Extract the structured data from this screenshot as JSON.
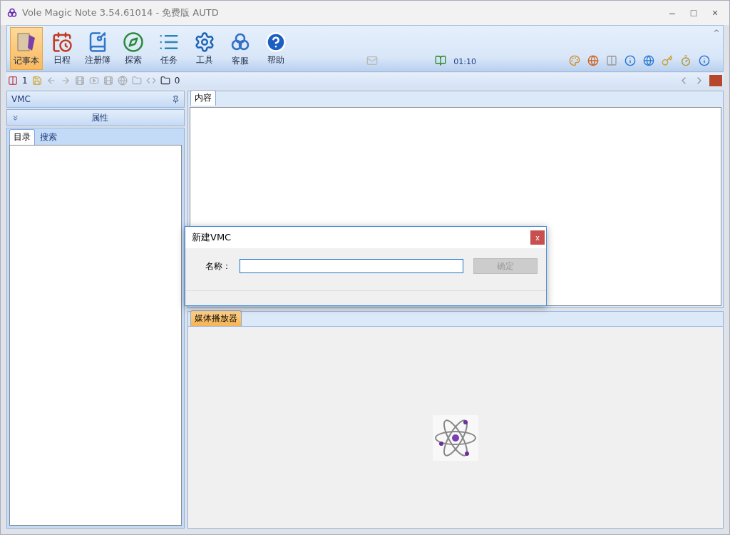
{
  "window": {
    "title": "Vole Magic Note  3.54.61014 - 免费版 AUTD",
    "controls": [
      "–",
      "□",
      "×"
    ]
  },
  "ribbon": {
    "buttons": [
      {
        "label": "记事本",
        "selected": true
      },
      {
        "label": "日程",
        "selected": false
      },
      {
        "label": "注册簿",
        "selected": false
      },
      {
        "label": "探索",
        "selected": false
      },
      {
        "label": "任务",
        "selected": false
      },
      {
        "label": "工具",
        "selected": false
      },
      {
        "label": "客服",
        "selected": false
      },
      {
        "label": "帮助",
        "selected": false
      }
    ],
    "timer": "01:10"
  },
  "toolbar": {
    "notebook_count": "1",
    "attachment_count": "0"
  },
  "left_panel": {
    "title": "VMC",
    "properties": "属性",
    "tabs": [
      {
        "label": "目录",
        "selected": true
      },
      {
        "label": "搜索",
        "selected": false
      }
    ]
  },
  "content_pane": {
    "tabs": [
      {
        "label": "内容",
        "selected": true
      }
    ]
  },
  "media_pane": {
    "tabs": [
      {
        "label": "媒体播放器",
        "selected": true
      }
    ]
  },
  "dialog": {
    "title": "新建VMC",
    "close": "x",
    "field_label": "名称：",
    "confirm": {
      "label": "确定",
      "disabled": true
    }
  }
}
